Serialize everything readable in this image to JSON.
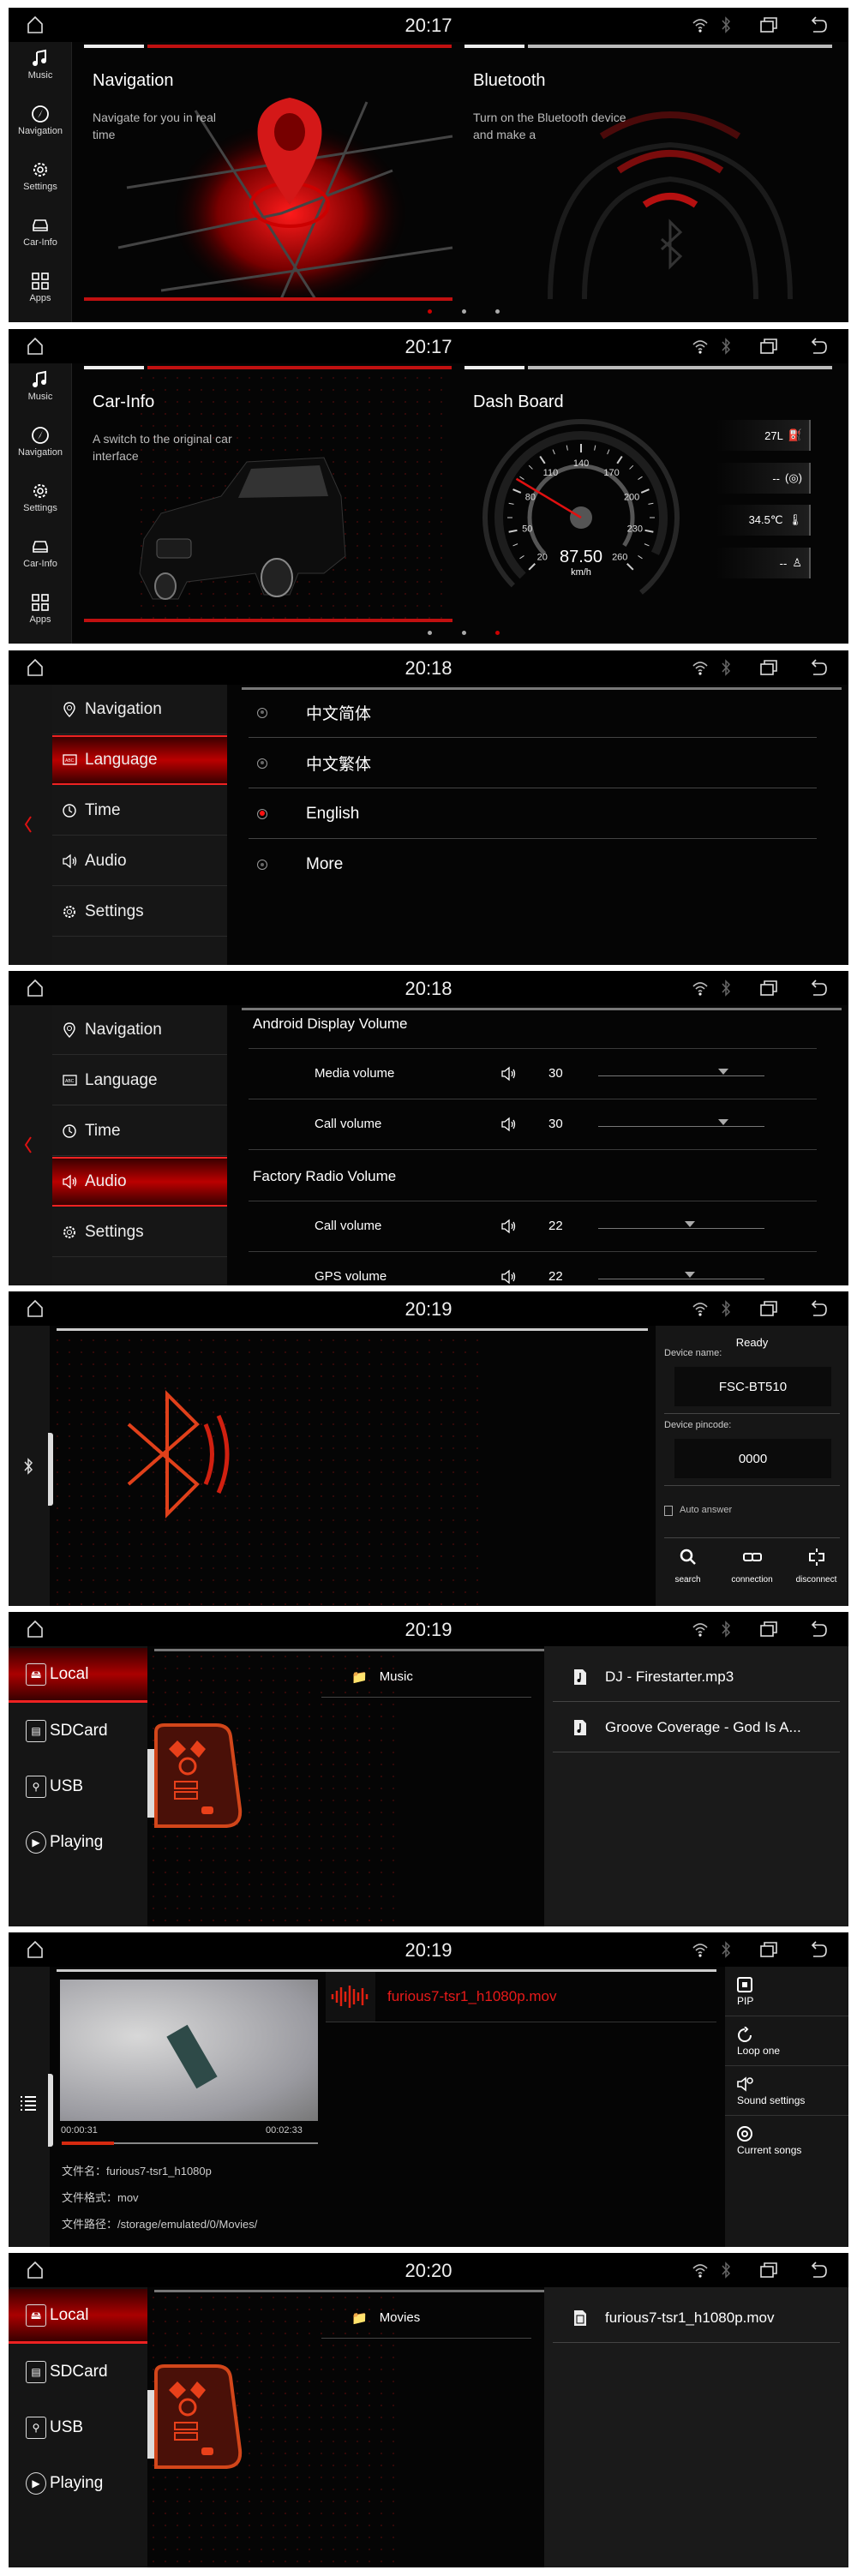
{
  "colors": {
    "accent": "#e01010",
    "background": "#050505",
    "panel": "#161616"
  },
  "status_icons": [
    "home-icon",
    "wifi-icon",
    "bluetooth-icon",
    "recent-apps-icon",
    "back-icon"
  ],
  "launcher_sidebar": [
    {
      "label": "Music",
      "icon": "music-note-icon"
    },
    {
      "label": "Navigation",
      "icon": "compass-icon"
    },
    {
      "label": "Settings",
      "icon": "gear-icon"
    },
    {
      "label": "Car-Info",
      "icon": "car-icon"
    },
    {
      "label": "Apps",
      "icon": "grid-icon"
    }
  ],
  "screens": {
    "home1": {
      "time": "20:17",
      "cards": [
        {
          "title": "Navigation",
          "subtitle": "Navigate for you in real time"
        },
        {
          "title": "Bluetooth",
          "subtitle": "Turn on the Bluetooth device and make a"
        }
      ],
      "page_index": 0,
      "page_count": 3
    },
    "home2": {
      "time": "20:17",
      "cards": [
        {
          "title": "Car-Info",
          "subtitle": "A switch to the original car interface"
        },
        {
          "title": "Dash Board"
        }
      ],
      "gauge": {
        "ticks": [
          "20",
          "50",
          "80",
          "110",
          "140",
          "170",
          "200",
          "230",
          "260"
        ],
        "speed": "87.50",
        "unit": "km/h",
        "needle_value": 87.5
      },
      "info": [
        "27L",
        "--",
        "34.5℃",
        "--"
      ],
      "info_icons": [
        "fuel-icon",
        "brake-icon",
        "thermometer-icon",
        "seatbelt-icon"
      ],
      "page_index": 2,
      "page_count": 3
    },
    "language": {
      "time": "20:18",
      "menu": [
        "Navigation",
        "Language",
        "Time",
        "Audio",
        "Settings"
      ],
      "selected_menu": "Language",
      "options": [
        "中文简体",
        "中文繁体",
        "English",
        "More"
      ],
      "selected_option": "English"
    },
    "audio": {
      "time": "20:18",
      "menu": [
        "Navigation",
        "Language",
        "Time",
        "Audio",
        "Settings"
      ],
      "selected_menu": "Audio",
      "sections": [
        {
          "title": "Android Display Volume",
          "rows": [
            {
              "label": "Media volume",
              "value": "30",
              "level": 0.75
            },
            {
              "label": "Call volume",
              "value": "30",
              "level": 0.75
            }
          ]
        },
        {
          "title": "Factory Radio Volume",
          "rows": [
            {
              "label": "Call volume",
              "value": "22",
              "level": 0.55
            },
            {
              "label": "GPS volume",
              "value": "22",
              "level": 0.55
            }
          ]
        }
      ]
    },
    "bluetooth": {
      "time": "20:19",
      "status": "Ready",
      "device_name_label": "Device name:",
      "device_name": "FSC-BT510",
      "pincode_label": "Device pincode:",
      "pincode": "0000",
      "auto_answer": "Auto answer",
      "auto_answer_checked": false,
      "actions": [
        "search",
        "connection",
        "disconnect"
      ]
    },
    "music": {
      "time": "20:19",
      "sources": [
        "Local",
        "SDCard",
        "USB",
        "Playing"
      ],
      "selected_source": "Local",
      "folder": "Music",
      "files": [
        "DJ - Firestarter.mp3",
        "Groove Coverage - God Is A..."
      ]
    },
    "video": {
      "time": "20:19",
      "title": "furious7-tsr1_h1080p.mov",
      "elapsed": "00:00:31",
      "total": "00:02:33",
      "progress": 0.203,
      "info": [
        "文件名：furious7-tsr1_h1080p",
        "文件格式：mov",
        "文件路径：/storage/emulated/0/Movies/"
      ],
      "actions": [
        "PIP",
        "Loop one",
        "Sound settings",
        "Current songs"
      ]
    },
    "movies": {
      "time": "20:20",
      "sources": [
        "Local",
        "SDCard",
        "USB",
        "Playing"
      ],
      "selected_source": "Local",
      "folder": "Movies",
      "files": [
        "furious7-tsr1_h1080p.mov"
      ]
    }
  }
}
